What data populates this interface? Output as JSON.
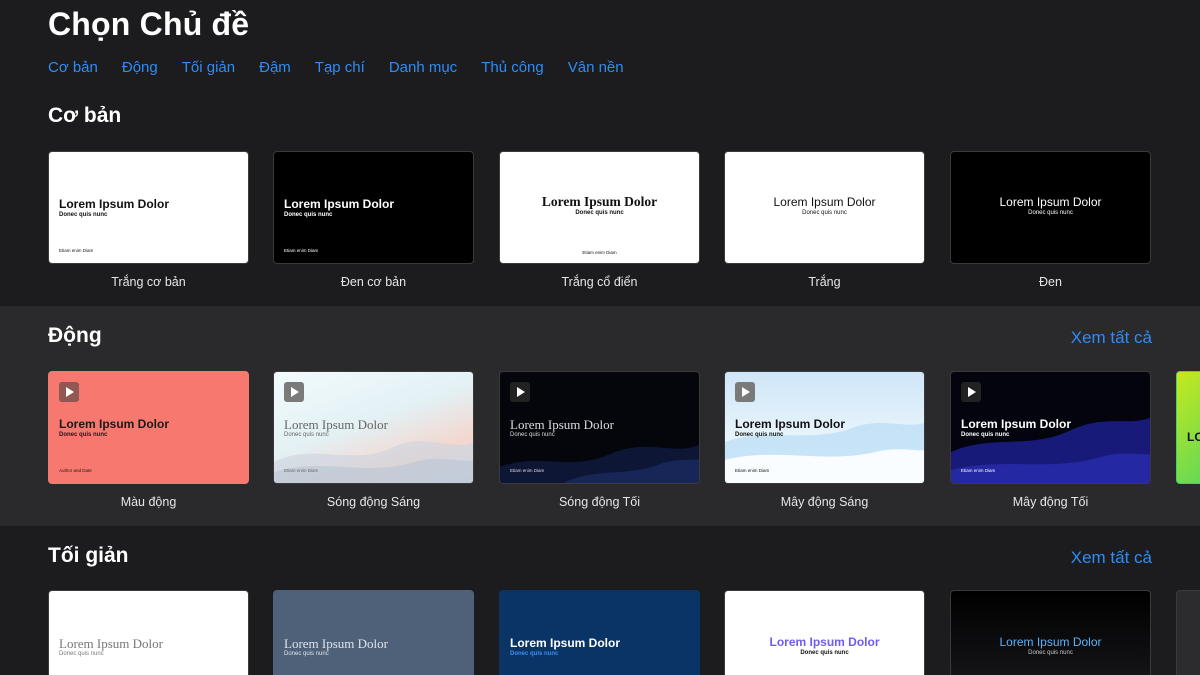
{
  "page_title": "Chọn Chủ đề",
  "nav": [
    "Cơ bản",
    "Động",
    "Tối giản",
    "Đậm",
    "Tạp chí",
    "Danh mục",
    "Thủ công",
    "Vân nền"
  ],
  "sections": {
    "basic": {
      "title": "Cơ bản"
    },
    "dynamic": {
      "title": "Động",
      "see_all": "Xem tất cả"
    },
    "minimal": {
      "title": "Tối giản",
      "see_all": "Xem tất cả"
    }
  },
  "thumb_text": {
    "title": "Lorem Ipsum Dolor",
    "subtitle": "Donec quis nunc",
    "footer": "Etiam enim Diam",
    "author": "Author and Date",
    "partial": "LO"
  },
  "themes": {
    "basic": [
      {
        "name": "Trắng cơ bản",
        "bg": "#ffffff",
        "fg": "#111111"
      },
      {
        "name": "Đen cơ bản",
        "bg": "#000000",
        "fg": "#ffffff"
      },
      {
        "name": "Trắng cổ điển",
        "bg": "#ffffff",
        "fg": "#111111"
      },
      {
        "name": "Trắng",
        "bg": "#ffffff",
        "fg": "#111111"
      },
      {
        "name": "Đen",
        "bg": "#000000",
        "fg": "#ffffff"
      }
    ],
    "dynamic": [
      {
        "name": "Màu động",
        "bg": "#f6786f",
        "fg": "#1a1a1a"
      },
      {
        "name": "Sóng động Sáng",
        "bg": "#e8f4f6",
        "fg": "#555555"
      },
      {
        "name": "Sóng động Tối",
        "bg": "#05050c",
        "fg": "#dddddd"
      },
      {
        "name": "Mây động Sáng",
        "bg": "#dff0fb",
        "fg": "#111111"
      },
      {
        "name": "Mây động Tối",
        "bg": "#04040f",
        "fg": "#ffffff"
      }
    ],
    "minimal": [
      {
        "bg": "#ffffff",
        "fg": "#777777"
      },
      {
        "bg": "#4f6079",
        "fg": "#dfe4ea"
      },
      {
        "bg": "#0a3466",
        "fg": "#ffffff",
        "accent": "#3b8ff0"
      },
      {
        "bg": "#ffffff",
        "fg": "#111111",
        "accent": "#6c5cf0"
      },
      {
        "bg": "#0b0b0d",
        "fg": "#cccccc",
        "accent": "#5fb0f5"
      }
    ]
  },
  "colors": {
    "accent": "#2f8cf5",
    "background": "#1c1c1e",
    "section_alt": "#2a2a2c"
  }
}
